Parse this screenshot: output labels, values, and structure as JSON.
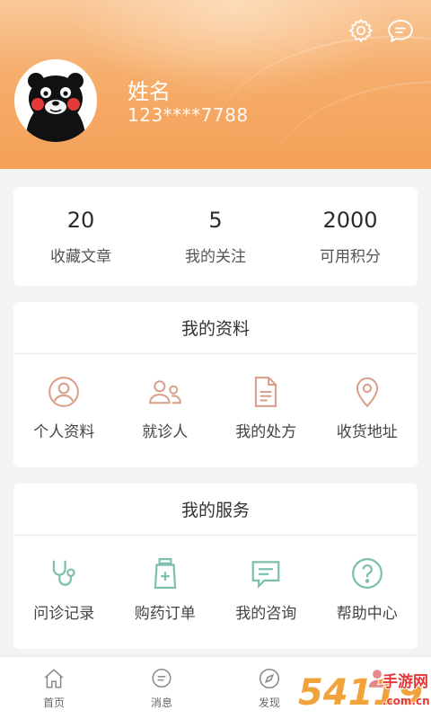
{
  "colors": {
    "header_gradient_top": "#f9c89a",
    "header_gradient_bottom": "#f4a057",
    "profile_icon_color": "#d9a089",
    "service_icon_color": "#7cbfae",
    "nav_icon_color": "#8a8a8a",
    "nav_active_color": "#e4888a"
  },
  "header": {
    "settings_icon": "gear-icon",
    "message_icon": "chat-bubble-icon",
    "user_name": "姓名",
    "user_phone": "123****7788"
  },
  "stats": [
    {
      "value": "20",
      "label": "收藏文章"
    },
    {
      "value": "5",
      "label": "我的关注"
    },
    {
      "value": "2000",
      "label": "可用积分"
    }
  ],
  "profile_section": {
    "title": "我的资料",
    "items": [
      {
        "label": "个人资料",
        "icon": "user-circle-icon"
      },
      {
        "label": "就诊人",
        "icon": "users-icon"
      },
      {
        "label": "我的处方",
        "icon": "document-icon"
      },
      {
        "label": "收货地址",
        "icon": "location-pin-icon"
      }
    ]
  },
  "service_section": {
    "title": "我的服务",
    "items": [
      {
        "label": "问诊记录",
        "icon": "stethoscope-icon"
      },
      {
        "label": "购药订单",
        "icon": "medicine-bag-icon"
      },
      {
        "label": "我的咨询",
        "icon": "chat-lines-icon"
      },
      {
        "label": "帮助中心",
        "icon": "help-circle-icon"
      }
    ]
  },
  "bottom_nav": [
    {
      "label": "首页",
      "icon": "home-icon"
    },
    {
      "label": "消息",
      "icon": "message-icon"
    },
    {
      "label": "发现",
      "icon": "compass-icon"
    },
    {
      "label": "",
      "icon": "person-icon",
      "active": true
    }
  ],
  "watermark": {
    "text_main": "54119",
    "text_cn": "手游网",
    "text_domain": ".com.cn"
  }
}
